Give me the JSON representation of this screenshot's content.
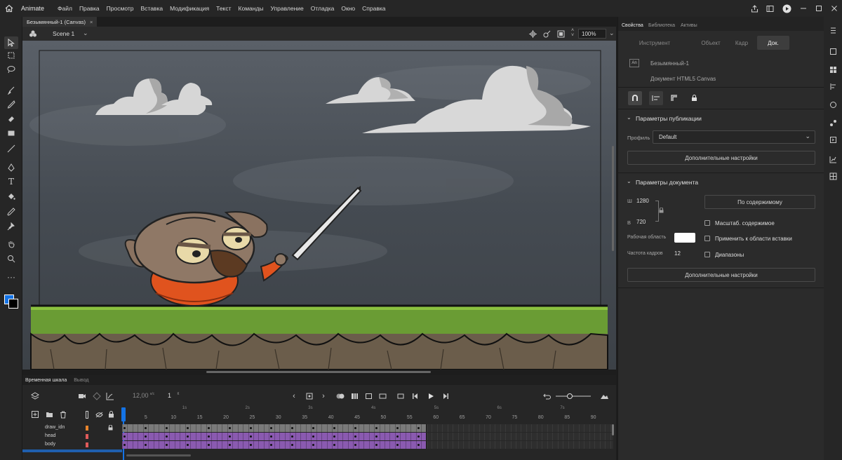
{
  "app": {
    "name": "Animate"
  },
  "menu": [
    "Файл",
    "Правка",
    "Просмотр",
    "Вставка",
    "Модификация",
    "Текст",
    "Команды",
    "Управление",
    "Отладка",
    "Окно",
    "Справка"
  ],
  "document": {
    "tab_title": "Безымянный-1 (Canvas)",
    "close_glyph": "×",
    "scene": "Scene 1",
    "zoom": "100%"
  },
  "panel": {
    "tabs": [
      "Свойства",
      "Библиотека",
      "Активы"
    ],
    "segments": [
      "Инструмент",
      "Объект",
      "Кадр",
      "Док."
    ],
    "doc_name": "Безымянный-1",
    "doc_type": "Документ HTML5 Canvas",
    "doc_badge": "An",
    "publish": {
      "header": "Параметры публикации",
      "profile_label": "Профиль",
      "profile_value": "Default",
      "more_button": "Дополнительные настройки"
    },
    "docsettings": {
      "header": "Параметры документа",
      "w_label": "Ш",
      "w_value": "1280",
      "h_label": "В",
      "h_value": "720",
      "fit_button": "По содержимому",
      "stage_label": "Рабочая область",
      "stage_color": "#ffffff",
      "fps_label": "Частота кадров",
      "fps_value": "12",
      "checkboxes": [
        "Масштаб. содержимое",
        "Применить к области вставки",
        "Диапазоны"
      ],
      "more_button": "Дополнительные настройки"
    }
  },
  "timeline": {
    "tabs": [
      "Временная шкала",
      "Вывод"
    ],
    "fps": "12,00",
    "fps_unit": "к/с",
    "frame": "1",
    "frame_unit": "К",
    "frame_numbers": [
      "5",
      "10",
      "15",
      "20",
      "25",
      "30",
      "35",
      "40",
      "45",
      "50",
      "55",
      "60",
      "65",
      "70",
      "75",
      "80",
      "85",
      "90"
    ],
    "seconds": [
      "1s",
      "2s",
      "3s",
      "4s",
      "5s",
      "6s",
      "7s"
    ],
    "layers": [
      {
        "name": "draw_idn",
        "color": "#e8842c",
        "locked": true
      },
      {
        "name": "head",
        "color": "#e05a5a",
        "locked": false
      },
      {
        "name": "body",
        "color": "#e05a5a",
        "locked": false
      }
    ]
  },
  "colors": {
    "accent": "#1473e6",
    "purple_frames": "#8a5ab0",
    "grey_frames": "#7a7a7a"
  }
}
